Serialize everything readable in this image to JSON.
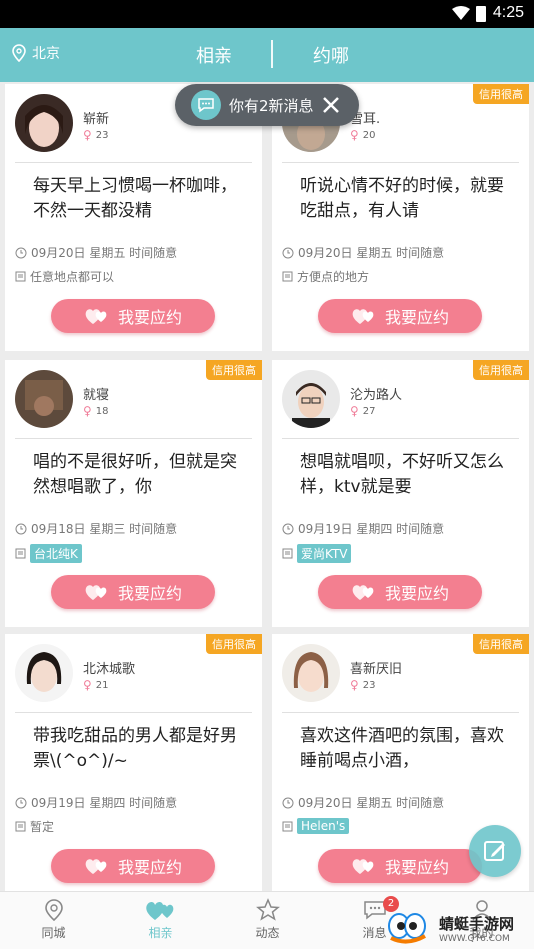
{
  "status_bar": {
    "time": "4:25"
  },
  "header": {
    "location": "北京",
    "tab_active": "相亲",
    "tab_other": "约哪"
  },
  "toast": {
    "text": "你有2新消息"
  },
  "cards": [
    {
      "name": "崭新",
      "age": "23",
      "badge": "",
      "content": "每天早上习惯喝一杯咖啡，不然一天都没精",
      "when": "09月20日 星期五 时间随意",
      "where": "任意地点都可以",
      "where_is_tag": false,
      "button": "我要应约"
    },
    {
      "name": "雪耳.",
      "age": "20",
      "badge": "信用很高",
      "content": "听说心情不好的时候，就要吃甜点，有人请",
      "when": "09月20日 星期五 时间随意",
      "where": "方便点的地方",
      "where_is_tag": false,
      "button": "我要应约"
    },
    {
      "name": "就寝",
      "age": "18",
      "badge": "信用很高",
      "content": "唱的不是很好听，但就是突然想唱歌了，你",
      "when": "09月18日 星期三 时间随意",
      "where": "台北纯K",
      "where_is_tag": true,
      "button": "我要应约"
    },
    {
      "name": "沦为路人",
      "age": "27",
      "badge": "信用很高",
      "content": "想唱就唱呗，不好听又怎么样，ktv就是要",
      "when": "09月19日 星期四 时间随意",
      "where": "爱尚KTV",
      "where_is_tag": true,
      "button": "我要应约"
    },
    {
      "name": "北沐城歌",
      "age": "21",
      "badge": "信用很高",
      "content": "带我吃甜品的男人都是好男票\\(^o^)/~",
      "when": "09月19日 星期四 时间随意",
      "where": "暂定",
      "where_is_tag": false,
      "button": "我要应约"
    },
    {
      "name": "喜新厌旧",
      "age": "23",
      "badge": "信用很高",
      "content": "喜欢这件酒吧的氛围，喜欢睡前喝点小酒，",
      "when": "09月20日 星期五 时间随意",
      "where": "Helen's",
      "where_is_tag": true,
      "button": "我要应约"
    }
  ],
  "bottom_nav": [
    {
      "label": "同城",
      "icon": "location-icon"
    },
    {
      "label": "相亲",
      "icon": "hearts-icon"
    },
    {
      "label": "动态",
      "icon": "star-icon"
    },
    {
      "label": "消息",
      "icon": "chat-icon",
      "badge": "2"
    },
    {
      "label": "我的",
      "icon": "person-icon"
    }
  ],
  "watermark": {
    "title": "蜻蜓手游网",
    "url": "WWW.QT6.COM"
  },
  "colors": {
    "primary": "#6ec6cb",
    "button": "#f37f90",
    "badge": "#f5a623"
  }
}
